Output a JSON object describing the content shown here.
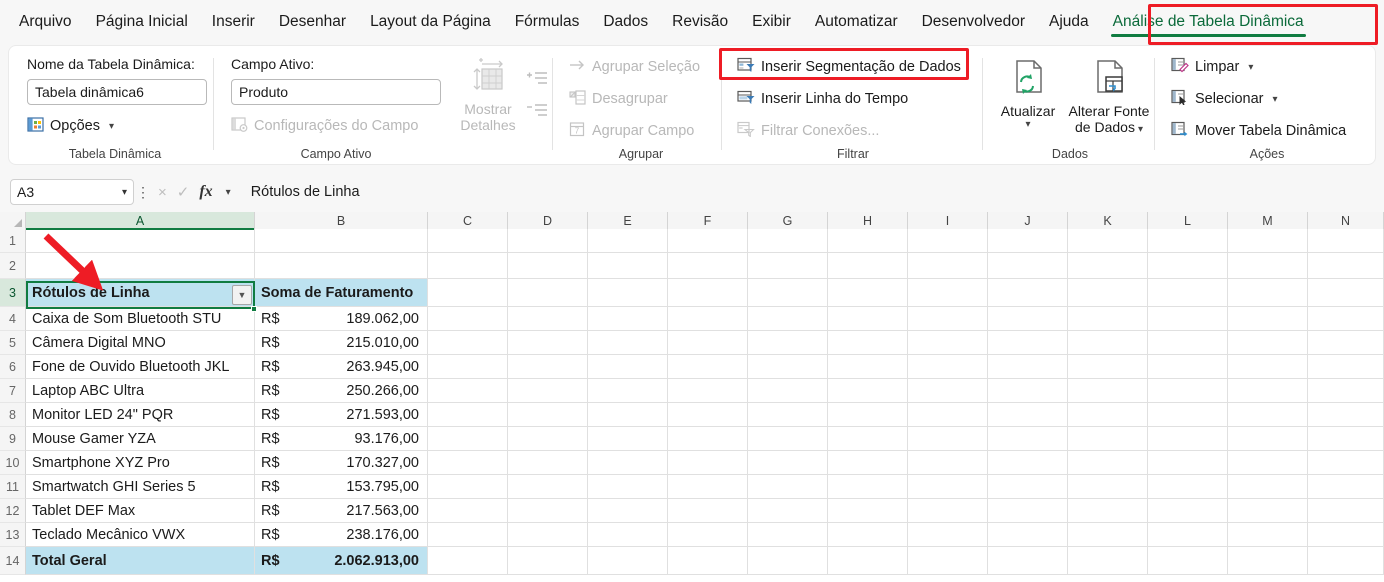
{
  "tabs": [
    {
      "label": "Arquivo",
      "active": false
    },
    {
      "label": "Página Inicial",
      "active": false
    },
    {
      "label": "Inserir",
      "active": false
    },
    {
      "label": "Desenhar",
      "active": false
    },
    {
      "label": "Layout da Página",
      "active": false
    },
    {
      "label": "Fórmulas",
      "active": false
    },
    {
      "label": "Dados",
      "active": false
    },
    {
      "label": "Revisão",
      "active": false
    },
    {
      "label": "Exibir",
      "active": false
    },
    {
      "label": "Automatizar",
      "active": false
    },
    {
      "label": "Desenvolvedor",
      "active": false
    },
    {
      "label": "Ajuda",
      "active": false
    },
    {
      "label": "Análise de Tabela Dinâmica",
      "active": true
    }
  ],
  "ribbon": {
    "groups": [
      {
        "title": "Tabela Dinâmica"
      },
      {
        "title": "Campo Ativo"
      },
      {
        "title": "Agrupar"
      },
      {
        "title": "Filtrar"
      },
      {
        "title": "Dados"
      },
      {
        "title": "Ações"
      }
    ],
    "pivot_name_label": "Nome da Tabela Dinâmica:",
    "pivot_name_value": "Tabela dinâmica6",
    "options_label": "Opções",
    "active_field_label": "Campo Ativo:",
    "active_field_value": "Produto",
    "field_settings_label": "Configurações do Campo",
    "show_details_label_1": "Mostrar",
    "show_details_label_2": "Detalhes",
    "expand_label": "Expandir Campo",
    "collapse_label": "Recolher Campo",
    "group_selection_label": "Agrupar Seleção",
    "ungroup_label": "Desagrupar",
    "group_field_label": "Agrupar Campo",
    "insert_slicer_label": "Inserir Segmentação de Dados",
    "insert_timeline_label": "Inserir Linha do Tempo",
    "filter_connections_label": "Filtrar Conexões...",
    "refresh_label": "Atualizar",
    "change_source_label_1": "Alterar Fonte",
    "change_source_label_2": "de Dados",
    "clear_label": "Limpar",
    "select_label": "Selecionar",
    "move_pivot_label": "Mover Tabela Dinâmica"
  },
  "formula_bar": {
    "name_box": "A3",
    "cancel_icon": "×",
    "confirm_icon": "✓",
    "fx_icon": "fx",
    "formula_value": "Rótulos de Linha"
  },
  "grid": {
    "columns": [
      "A",
      "B",
      "C",
      "D",
      "E",
      "F",
      "G",
      "H",
      "I",
      "J",
      "K",
      "L",
      "M",
      "N"
    ],
    "selected_column": "A",
    "rows": [
      "1",
      "2",
      "3",
      "4",
      "5",
      "6",
      "7",
      "8",
      "9",
      "10",
      "11",
      "12",
      "13",
      "14"
    ],
    "selected_row": "3",
    "selected_cell": "A3",
    "header_a": "Rótulos de Linha",
    "header_b": "Soma de Faturamento",
    "currency_symbol": "R$",
    "data": [
      {
        "produto": "Caixa de Som Bluetooth STU",
        "valor": "189.062,00"
      },
      {
        "produto": "Câmera Digital MNO",
        "valor": "215.010,00"
      },
      {
        "produto": "Fone de Ouvido Bluetooth JKL",
        "valor": "263.945,00"
      },
      {
        "produto": "Laptop ABC Ultra",
        "valor": "250.266,00"
      },
      {
        "produto": "Monitor LED 24\" PQR",
        "valor": "271.593,00"
      },
      {
        "produto": "Mouse Gamer YZA",
        "valor": "93.176,00"
      },
      {
        "produto": "Smartphone XYZ Pro",
        "valor": "170.327,00"
      },
      {
        "produto": "Smartwatch GHI Series 5",
        "valor": "153.795,00"
      },
      {
        "produto": "Tablet DEF Max",
        "valor": "217.563,00"
      },
      {
        "produto": "Teclado Mecânico VWX",
        "valor": "238.176,00"
      }
    ],
    "total_label": "Total Geral",
    "total_value": "2.062.913,00"
  },
  "colors": {
    "accent_green": "#107c41",
    "tab_active_text": "#0b6a3a",
    "annotation_red": "#ee1c25",
    "pivot_header_bg": "#bde2f0"
  },
  "chart_data": null
}
